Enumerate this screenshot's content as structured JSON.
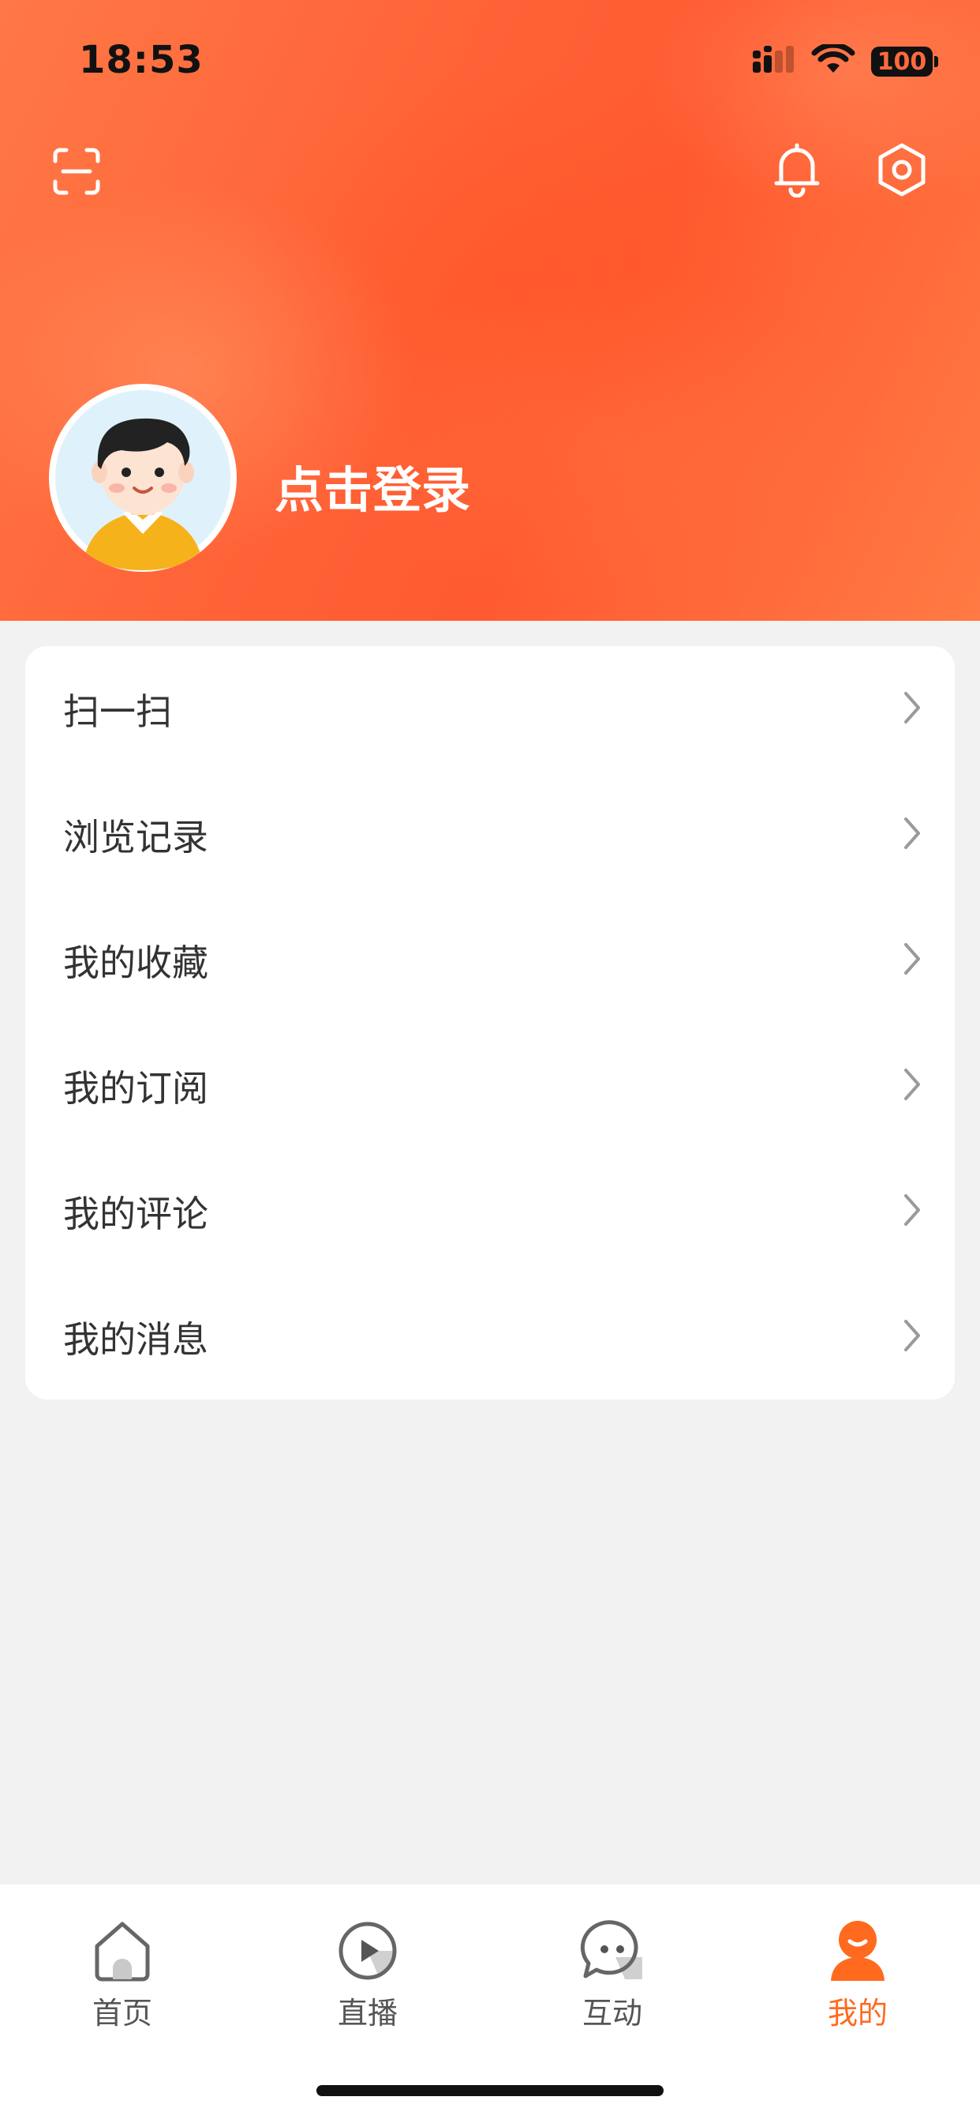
{
  "status_bar": {
    "time": "18:53",
    "battery": "100"
  },
  "header": {
    "icons": [
      "scan-icon",
      "bell-icon",
      "settings-icon"
    ],
    "login_text": "点击登录",
    "background_color": "#ff6236"
  },
  "menu": {
    "items": [
      {
        "label": "扫一扫"
      },
      {
        "label": "浏览记录"
      },
      {
        "label": "我的收藏"
      },
      {
        "label": "我的订阅"
      },
      {
        "label": "我的评论"
      },
      {
        "label": "我的消息"
      }
    ]
  },
  "tabbar": {
    "active_color": "#ff6a1f",
    "items": [
      {
        "label": "首页",
        "icon": "home-icon"
      },
      {
        "label": "直播",
        "icon": "live-icon"
      },
      {
        "label": "互动",
        "icon": "chat-icon"
      },
      {
        "label": "我的",
        "icon": "profile-icon",
        "active": true
      }
    ]
  }
}
